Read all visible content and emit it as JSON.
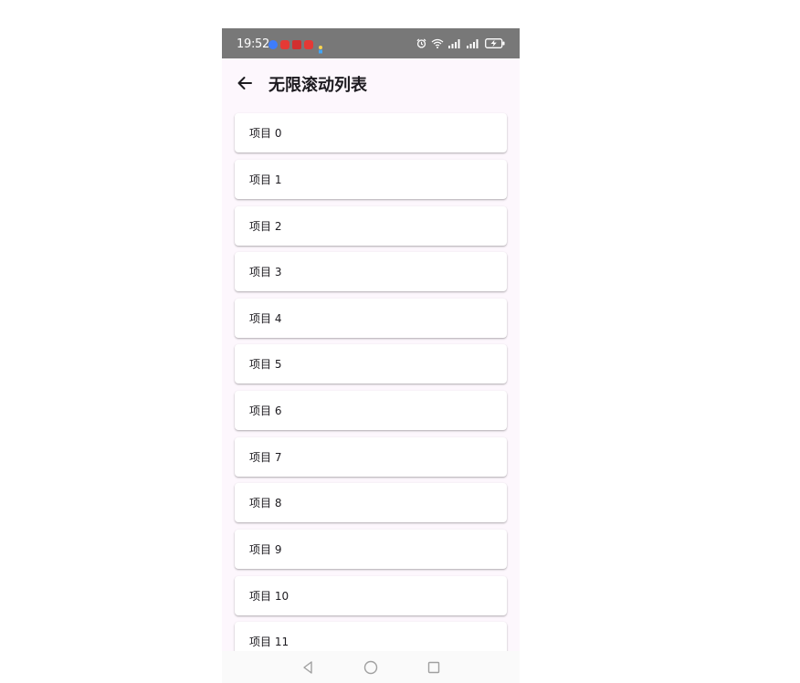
{
  "status_bar": {
    "time": "19:52",
    "notification_icons": [
      {
        "icon": "app-blue-icon",
        "color": "#3d7dfc"
      },
      {
        "icon": "app-red-icon",
        "color": "#e53935"
      },
      {
        "icon": "app-red-gift-icon",
        "color": "#d32f2f"
      },
      {
        "icon": "app-red-icon",
        "color": "#e53935"
      },
      {
        "icon": "app-person-icon",
        "color": "#ffd54f"
      }
    ],
    "system_icons": [
      "alarm-icon",
      "wifi-icon",
      "signal-icon",
      "signal-icon",
      "battery-charging-icon"
    ]
  },
  "app_bar": {
    "title": "无限滚动列表",
    "back_icon": "arrow-left-icon"
  },
  "list": {
    "items": [
      {
        "label": "项目 0"
      },
      {
        "label": "项目 1"
      },
      {
        "label": "项目 2"
      },
      {
        "label": "项目 3"
      },
      {
        "label": "项目 4"
      },
      {
        "label": "项目 5"
      },
      {
        "label": "项目 6"
      },
      {
        "label": "项目 7"
      },
      {
        "label": "项目 8"
      },
      {
        "label": "项目 9"
      },
      {
        "label": "项目 10"
      },
      {
        "label": "项目 11"
      }
    ]
  },
  "nav_bar": {
    "buttons": [
      "back-triangle-icon",
      "home-circle-icon",
      "recents-square-icon"
    ]
  },
  "colors": {
    "status_bar_bg": "#787878",
    "background": "#fdf7fd",
    "card_bg": "#ffffff",
    "text": "#1d1b20"
  }
}
